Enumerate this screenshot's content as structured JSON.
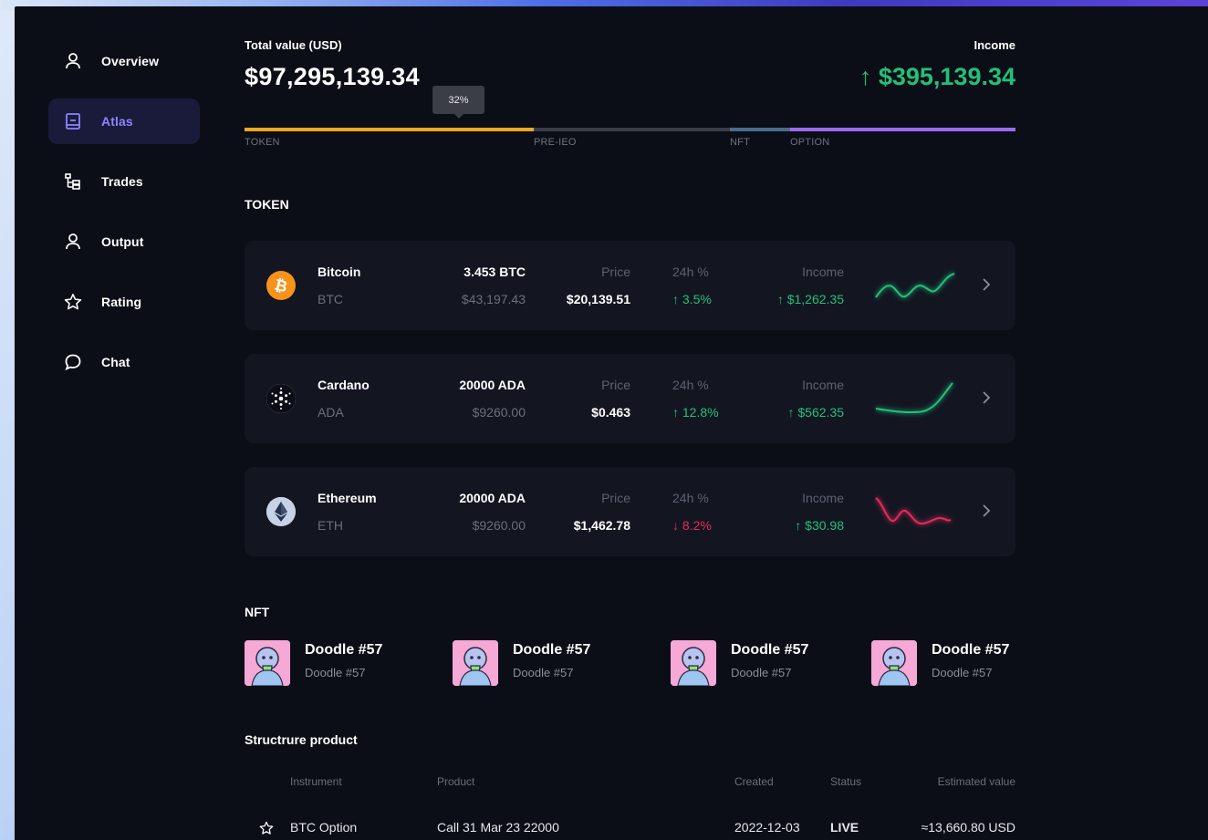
{
  "sidebar": {
    "items": [
      {
        "label": "Overview",
        "icon": "user-icon",
        "active": false
      },
      {
        "label": "Atlas",
        "icon": "book-icon",
        "active": true
      },
      {
        "label": "Trades",
        "icon": "tree-icon",
        "active": false
      },
      {
        "label": "Output",
        "icon": "user-icon",
        "active": false
      },
      {
        "label": "Rating",
        "icon": "star-icon",
        "active": false
      },
      {
        "label": "Chat",
        "icon": "chat-icon",
        "active": false
      }
    ]
  },
  "summary": {
    "total_label": "Total value (USD)",
    "total_value": "$97,295,139.34",
    "income_label": "Income",
    "income_value": "↑ $395,139.34",
    "tooltip": "32%"
  },
  "allocation": {
    "segments": [
      {
        "label": "TOKEN",
        "color": "#f5a623",
        "fraction": 0.375
      },
      {
        "label": "PRE-IEO",
        "color": "#3a3d47",
        "fraction": 0.255
      },
      {
        "label": "NFT",
        "color": "#4a6c8f",
        "fraction": 0.078
      },
      {
        "label": "OPTION",
        "color": "#9b6cf0",
        "fraction": 0.292
      }
    ]
  },
  "token_section": {
    "title": "TOKEN",
    "price_label": "Price",
    "change_label": "24h %",
    "income_label": "Income",
    "tokens": [
      {
        "name": "Bitcoin",
        "symbol": "BTC",
        "amount": "3.453 BTC",
        "fiat": "$43,197.43",
        "price": "$20,139.51",
        "change": "↑ 3.5%",
        "direction": "up",
        "income": "↑ $1,262.35",
        "icon": "bitcoin-icon"
      },
      {
        "name": "Cardano",
        "symbol": "ADA",
        "amount": "20000 ADA",
        "fiat": "$9260.00",
        "price": "$0.463",
        "change": "↑ 12.8%",
        "direction": "up",
        "income": "↑ $562.35",
        "icon": "cardano-icon"
      },
      {
        "name": "Ethereum",
        "symbol": "ETH",
        "amount": "20000 ADA",
        "fiat": "$9260.00",
        "price": "$1,462.78",
        "change": "↓ 8.2%",
        "direction": "down",
        "income": "↑ $30.98",
        "icon": "ethereum-icon"
      }
    ]
  },
  "nft_section": {
    "title": "NFT",
    "items": [
      {
        "title": "Doodle #57",
        "subtitle": "Doodle #57"
      },
      {
        "title": "Doodle #57",
        "subtitle": "Doodle #57"
      },
      {
        "title": "Doodle #57",
        "subtitle": "Doodle #57"
      },
      {
        "title": "Doodle #57",
        "subtitle": "Doodle #57"
      }
    ]
  },
  "structure_section": {
    "title": "Structrure product",
    "headers": {
      "instrument": "Instrument",
      "product": "Product",
      "created": "Created",
      "status": "Status",
      "estimated": "Estimated value"
    },
    "rows": [
      {
        "instrument": "BTC Option",
        "product": "Call 31 Mar 23 22000",
        "created": "2022-12-03",
        "status": "LIVE",
        "estimated": "≈13,660.80 USD"
      }
    ]
  },
  "colors": {
    "accent": "#8e83ff",
    "positive": "#22c07a",
    "negative": "#e52a5a",
    "background": "#0b0e16",
    "card": "#131621"
  }
}
